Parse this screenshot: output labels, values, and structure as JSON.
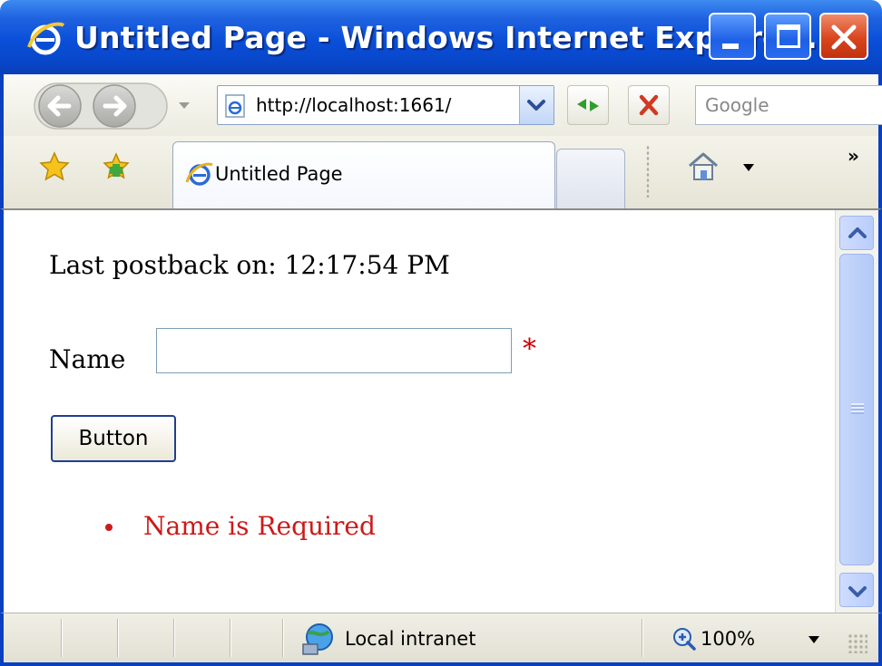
{
  "window": {
    "title": "Untitled Page - Windows Internet Explore...",
    "title_icon": "ie-logo-icon",
    "controls": [
      "minimize-icon",
      "maximize-icon",
      "close-icon"
    ]
  },
  "nav": {
    "address": "http://localhost:1661/",
    "search_placeholder": "Google",
    "icons": [
      "back-icon",
      "forward-icon",
      "refresh-icon",
      "stop-icon",
      "search-icon"
    ]
  },
  "tabs": {
    "active_label": "Untitled Page",
    "more_label": "»",
    "icons": [
      "favorites-star-icon",
      "add-favorites-icon",
      "home-icon"
    ]
  },
  "page": {
    "postback_label": "Last postback on:",
    "postback_time": "12:17:54 PM",
    "name_label": "Name",
    "name_value": "",
    "required_marker": "*",
    "button_label": "Button",
    "errors": [
      "Name is Required"
    ]
  },
  "status": {
    "zone": "Local intranet",
    "zoom": "100%",
    "icons": [
      "local-intranet-icon",
      "zoom-icon"
    ]
  },
  "colors": {
    "title_bar": "#0a4fd8",
    "error_text": "#cc1a1a",
    "required_marker": "#cc0000"
  }
}
